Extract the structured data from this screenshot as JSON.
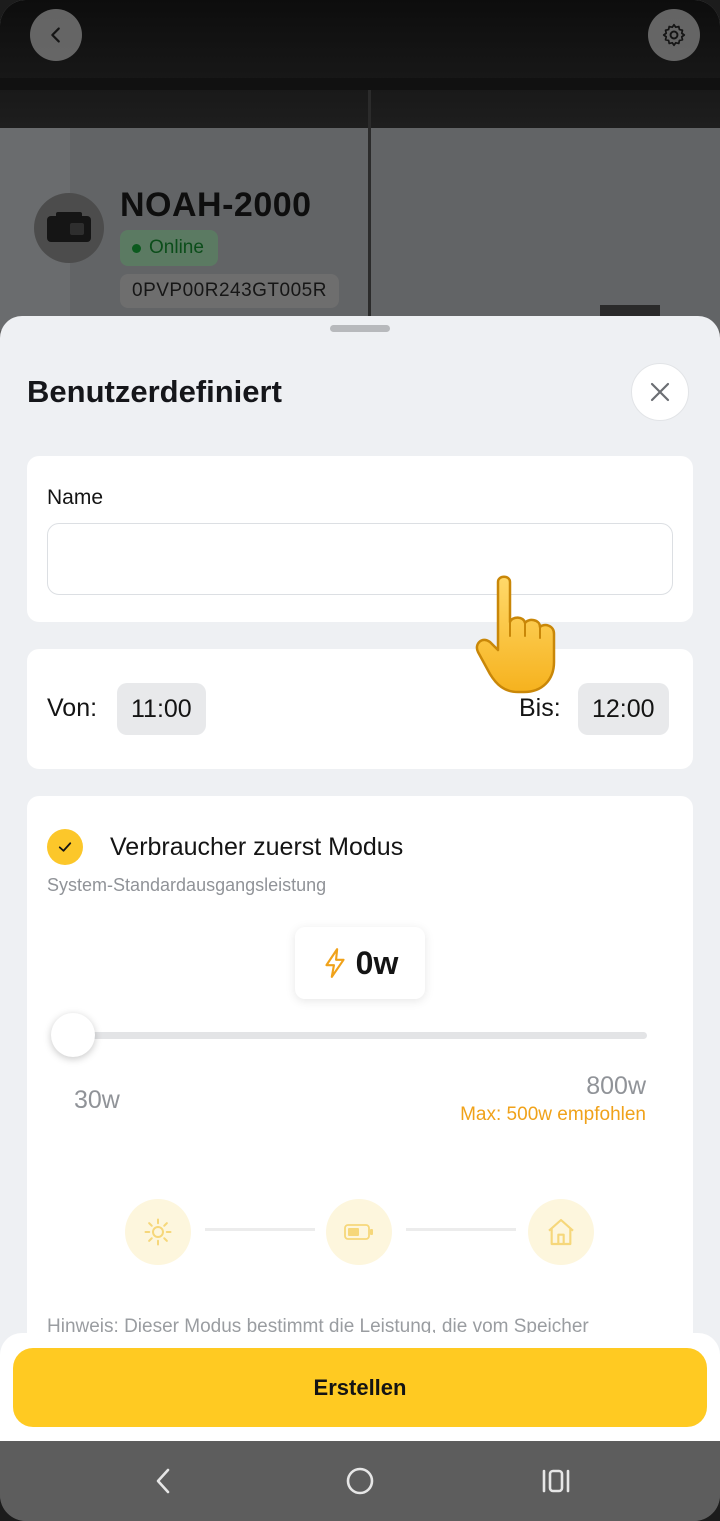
{
  "device": {
    "name": "NOAH-2000",
    "status": "Online",
    "serial": "0PVP00R243GT005R"
  },
  "sheet": {
    "title": "Benutzerdefiniert"
  },
  "name_field": {
    "label": "Name",
    "value": "",
    "placeholder": ""
  },
  "time": {
    "from_label": "Von:",
    "from_value": "11:00",
    "to_label": "Bis:",
    "to_value": "12:00"
  },
  "mode": {
    "title": "Verbraucher zuerst Modus",
    "subtitle": "System-Standardausgangsleistung",
    "checked": true,
    "power_value": "0w",
    "slider_min_label": "30w",
    "slider_max_label": "800w",
    "slider_fraction": 0,
    "max_hint": "Max: 500w empfohlen",
    "flow_icons": [
      "sun-icon",
      "battery-icon",
      "house-icon"
    ],
    "hint": "Hinweis: Dieser Modus bestimmt die Leistung, die vom Speicher"
  },
  "actions": {
    "create_label": "Erstellen"
  },
  "colors": {
    "accent": "#FFCA22",
    "warning": "#F0A21A",
    "online": "#0B5A1E",
    "sheet_bg": "#EEF0F3"
  }
}
